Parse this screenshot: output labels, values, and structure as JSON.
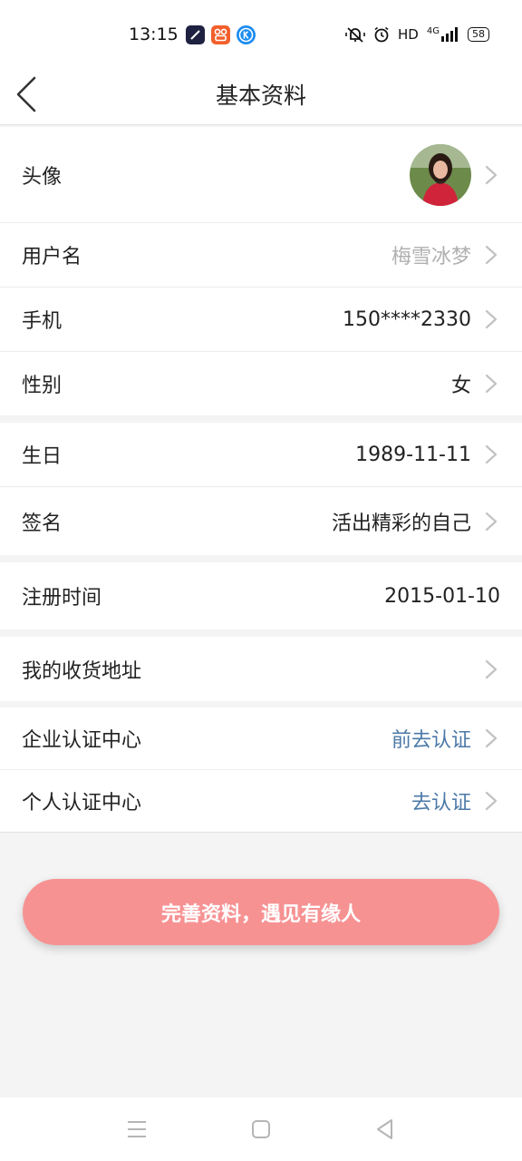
{
  "status_bar": {
    "time": "13:15",
    "network": "HD",
    "signal": "4G",
    "battery": "58",
    "icons": [
      "app-icon-dark",
      "app-icon-orange",
      "app-icon-blue",
      "mute-icon",
      "alarm-icon",
      "signal-icon"
    ]
  },
  "header": {
    "title": "基本资料",
    "back_icon": "chevron-left-icon"
  },
  "rows": {
    "avatar": {
      "label": "头像"
    },
    "username": {
      "label": "用户名",
      "value": "梅雪冰梦"
    },
    "phone": {
      "label": "手机",
      "value": "150****2330"
    },
    "gender": {
      "label": "性别",
      "value": "女"
    },
    "birthday": {
      "label": "生日",
      "value": "1989-11-11"
    },
    "signature": {
      "label": "签名",
      "value": "活出精彩的自己"
    },
    "register_time": {
      "label": "注册时间",
      "value": "2015-01-10"
    },
    "address": {
      "label": "我的收货地址"
    },
    "enterprise": {
      "label": "企业认证中心",
      "value": "前去认证"
    },
    "personal": {
      "label": "个人认证中心",
      "value": "去认证"
    }
  },
  "submit": {
    "label": "完善资料，遇见有缘人"
  },
  "colors": {
    "accent_button": "#f79293",
    "link": "#4b79a8",
    "muted": "#b0b0b0",
    "background": "#f4f4f4"
  },
  "nav": {
    "icons": [
      "menu-icon",
      "home-icon",
      "back-triangle-icon"
    ]
  }
}
